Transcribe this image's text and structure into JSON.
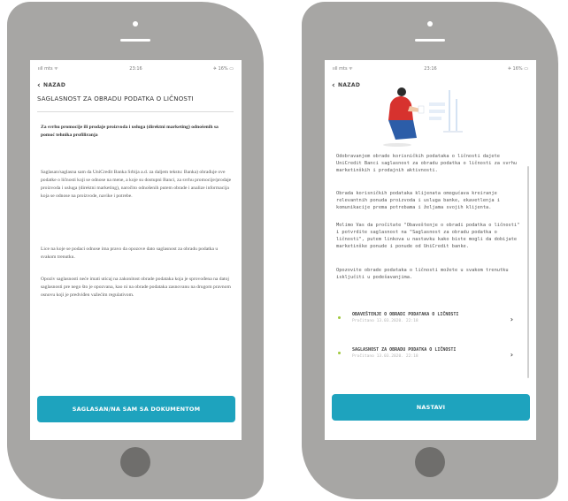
{
  "left_phone": {
    "status": {
      "signal": "ııll mts ᯤ",
      "time": "23:16",
      "battery": "✈ 16% ▭"
    },
    "back_label": "NAZAD",
    "title": "SAGLASNOST ZA OBRADU PODATKA O LIČNOSTI",
    "intro_bold": "Za svrhu promocije ili prodaje proizvoda i usluga (direktni marketing) odnošenih sa pomoć tehnika profiliranja",
    "paragraph_1": "Saglasan/saglasna sam da UniCredit Banka Srbija a.d. za daljem tekstu: Banka) obrađuje ove podatke o ličnosti koji se odnose na mene, a koje su dostupni Banci, za svrhu promocije/prodaje proizvoda i usluga (direktni marketing), naročito odnošenih putem obrade i analize informacija koja se odnose na proizvode, navike i potrebe.",
    "paragraph_2": "Lice na koje se podaci odnose ima pravo da opozove dato saglasnost za obradu podatka u svakom trenutku.",
    "paragraph_3": "Opoziv saglasnosti neće imati uticaj na zakonitost obrade podataka koja je sprovođena na datoj saglasnosti pre nego što je opozvana, kao ni na obrade podataka zasnovanu na drugom pravnom osnovu koji je predviđen važećim regulativom.",
    "button_label": "SAGLASAN/NA SAM SA DOKUMENTOM"
  },
  "right_phone": {
    "status": {
      "signal": "ııll mts ᯤ",
      "time": "23:16",
      "battery": "✈ 16% ▭"
    },
    "back_label": "NAZAD",
    "paragraph_1": "Odobravanjem obrade korisničkih podataka o ličnosti dajete UniCredit Banci saglasnost za obradu podatka o ličnosti za svrhu marketinških i prodajnih aktivnosti.",
    "paragraph_2": "Obrada korisničkih podataka klijenata omogućava kreiranje relevantnih ponuda proizvoda i usluga banke, ekavetlenja i komunikacije prema potrebama i željama svojih klijenta.",
    "paragraph_3": "Molimo Vas da pročitate \"Obaveštenje o obradi podatka o ličnosti\" i potvrdite saglasnost na \"Saglasnost za obradu podatka o ličnosti\", putem linkova u nastavku kako biste mogli da dobijate marketinške ponude i ponude od UniCredit banke.",
    "paragraph_4": "Opozovite obrade podataka o ličnosti možete u svakom trenutku isključiti u podešavanjima.",
    "documents": [
      {
        "title": "OBAVEŠTENJE O OBRADI PODATAKA O LIČNOSTI",
        "date": "Pročitano 13.03.2020. 22:18",
        "arrow": "›"
      },
      {
        "title": "SAGLASNOST ZA OBRADU PODATKA O LIČNOSTI",
        "date": "Pročitano 13.03.2020. 22:18",
        "arrow": "›"
      }
    ],
    "button_label": "NASTAVI"
  },
  "colors": {
    "phone_body": "#a7a6a4",
    "home_button": "#6f6e6c",
    "accent": "#1ea3be",
    "bullet": "#9fc93c",
    "illustration_red": "#d7322e",
    "illustration_blue": "#2c5da8"
  },
  "icons": [
    "back-chevron-icon",
    "signal-icon",
    "battery-icon",
    "document-arrow-icon",
    "person-illustration"
  ]
}
